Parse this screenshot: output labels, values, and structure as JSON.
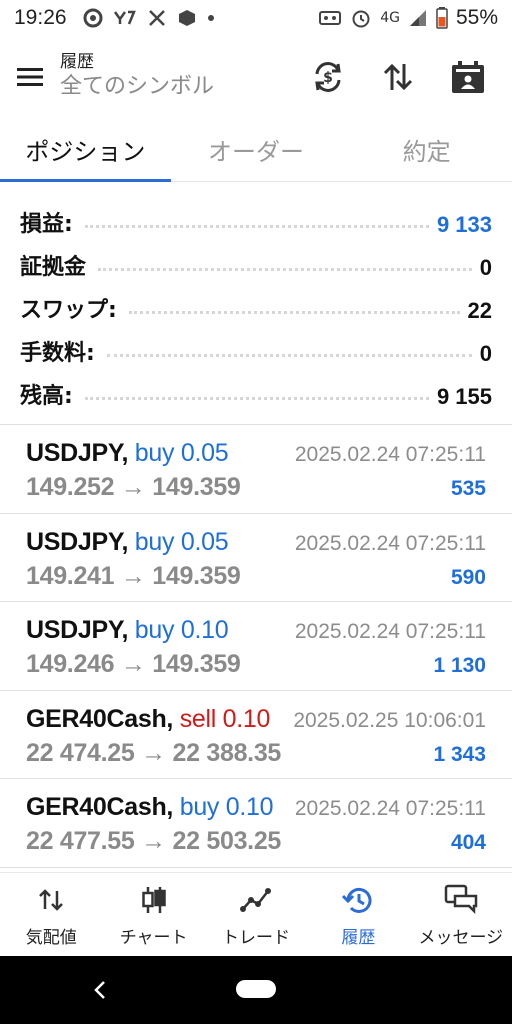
{
  "status_bar": {
    "time": "19:26",
    "network": "4G",
    "battery": "55%"
  },
  "toolbar": {
    "title": "履歴",
    "subtitle": "全てのシンボル",
    "icons": [
      "menu-icon",
      "currency-sync-icon",
      "sort-icon",
      "calendar-icon"
    ]
  },
  "tabs": [
    {
      "label": "ポジション",
      "active": true
    },
    {
      "label": "オーダー",
      "active": false
    },
    {
      "label": "約定",
      "active": false
    }
  ],
  "summary": [
    {
      "label": "損益:",
      "value": "9 133",
      "positive": true
    },
    {
      "label": "証拠金",
      "value": "0",
      "positive": false
    },
    {
      "label": "スワップ:",
      "value": "22",
      "positive": false
    },
    {
      "label": "手数料:",
      "value": "0",
      "positive": false
    },
    {
      "label": "残高:",
      "value": "9 155",
      "positive": false
    }
  ],
  "trades": [
    {
      "symbol": "USDJPY,",
      "side": "buy 0.05",
      "side_type": "buy",
      "prices": "149.252 → 149.359",
      "time": "2025.02.24 07:25:11",
      "profit": "535"
    },
    {
      "symbol": "USDJPY,",
      "side": "buy 0.05",
      "side_type": "buy",
      "prices": "149.241 → 149.359",
      "time": "2025.02.24 07:25:11",
      "profit": "590"
    },
    {
      "symbol": "USDJPY,",
      "side": "buy 0.10",
      "side_type": "buy",
      "prices": "149.246 → 149.359",
      "time": "2025.02.24 07:25:11",
      "profit": "1 130"
    },
    {
      "symbol": "GER40Cash,",
      "side": "sell 0.10",
      "side_type": "sell",
      "prices": "22 474.25 → 22 388.35",
      "time": "2025.02.25 10:06:01",
      "profit": "1 343"
    },
    {
      "symbol": "GER40Cash,",
      "side": "buy 0.10",
      "side_type": "buy",
      "prices": "22 477.55 → 22 503.25",
      "time": "2025.02.24 07:25:11",
      "profit": "404"
    }
  ],
  "bottom_nav": [
    {
      "label": "気配値",
      "icon": "quotes-icon",
      "active": false
    },
    {
      "label": "チャート",
      "icon": "candlestick-icon",
      "active": false
    },
    {
      "label": "トレード",
      "icon": "trade-line-icon",
      "active": false
    },
    {
      "label": "履歴",
      "icon": "history-icon",
      "active": true
    },
    {
      "label": "メッセージ",
      "icon": "messages-icon",
      "active": false
    }
  ],
  "colors": {
    "accent": "#2b6cd6",
    "profit": "#1e6fd9",
    "sell": "#d11a1a",
    "muted": "#8a8a8a"
  }
}
